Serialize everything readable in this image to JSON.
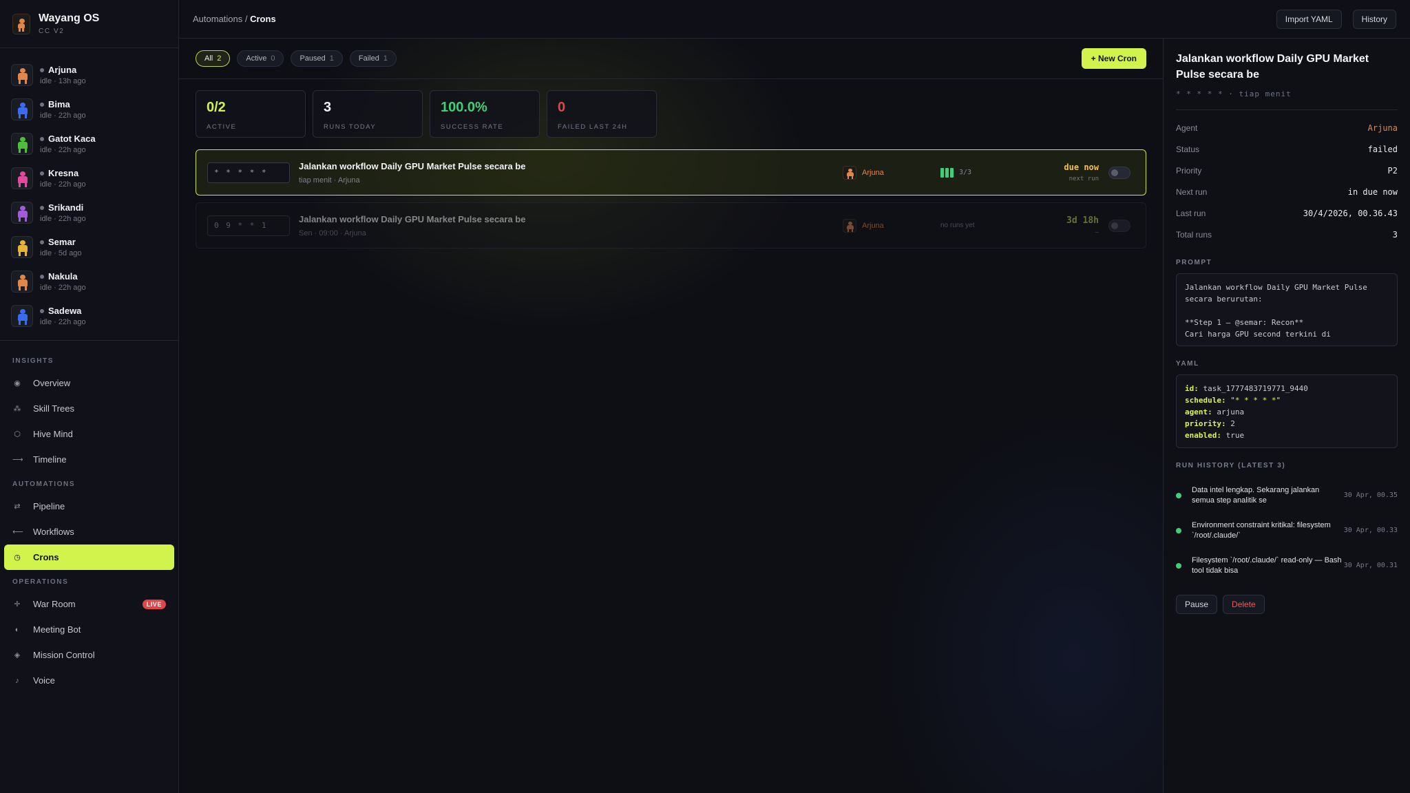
{
  "app": {
    "title": "Wayang OS",
    "subtitle": "CC V2"
  },
  "agents": [
    {
      "name": "Arjuna",
      "status": "idle · 13h ago",
      "color": "#e0874a"
    },
    {
      "name": "Bima",
      "status": "idle · 22h ago",
      "color": "#3b6cf0"
    },
    {
      "name": "Gatot Kaca",
      "status": "idle · 22h ago",
      "color": "#4fbf3a"
    },
    {
      "name": "Kresna",
      "status": "idle · 22h ago",
      "color": "#e04a9a"
    },
    {
      "name": "Srikandi",
      "status": "idle · 22h ago",
      "color": "#a25bd8"
    },
    {
      "name": "Semar",
      "status": "idle · 5d ago",
      "color": "#e6b43a"
    },
    {
      "name": "Nakula",
      "status": "idle · 22h ago",
      "color": "#e0874a"
    },
    {
      "name": "Sadewa",
      "status": "idle · 22h ago",
      "color": "#3b6cf0"
    }
  ],
  "nav": {
    "insights_label": "INSIGHTS",
    "overview": "Overview",
    "skill_trees": "Skill Trees",
    "hive_mind": "Hive Mind",
    "timeline": "Timeline",
    "automations_label": "AUTOMATIONS",
    "pipeline": "Pipeline",
    "workflows": "Workflows",
    "crons": "Crons",
    "operations_label": "OPERATIONS",
    "war_room": "War Room",
    "live_badge": "LIVE",
    "meeting_bot": "Meeting Bot",
    "mission_control": "Mission Control",
    "voice": "Voice"
  },
  "topbar": {
    "crumb_parent": "Automations",
    "crumb_sep": " / ",
    "crumb_current": "Crons",
    "import_label": "Import YAML",
    "history_label": "History"
  },
  "filters": {
    "all": {
      "label": "All",
      "count": "2"
    },
    "active": {
      "label": "Active",
      "count": "0"
    },
    "paused": {
      "label": "Paused",
      "count": "1"
    },
    "failed": {
      "label": "Failed",
      "count": "1"
    },
    "new_cron_label": "+ New Cron"
  },
  "stats": [
    {
      "value": "0/2",
      "label": "ACTIVE",
      "color": "#d2f34c"
    },
    {
      "value": "3",
      "label": "RUNS TODAY",
      "color": "#f1f2f5"
    },
    {
      "value": "100.0%",
      "label": "SUCCESS RATE",
      "color": "#3fcf7a"
    },
    {
      "value": "0",
      "label": "FAILED LAST 24H",
      "color": "#e04747"
    }
  ],
  "crons": [
    {
      "schedule": "* * * * *",
      "title": "Jalankan workflow Daily GPU Market Pulse secara be",
      "sub": "tiap menit · Arjuna",
      "agent": "Arjuna",
      "runs": "3/3",
      "next": "due now",
      "next_sub": "next run"
    },
    {
      "schedule": "0 9 * * 1",
      "title": "Jalankan workflow Daily GPU Market Pulse secara be",
      "sub": "Sen · 09:00 · Arjuna",
      "agent": "Arjuna",
      "runs": "no runs yet",
      "next": "3d 18h",
      "next_sub": "—"
    }
  ],
  "detail": {
    "title": "Jalankan workflow Daily GPU Market Pulse secara be",
    "schedule": "* * * * * · tiap menit",
    "agent_k": "Agent",
    "agent_v": "Arjuna",
    "status_k": "Status",
    "status_v": "failed",
    "priority_k": "Priority",
    "priority_v": "P2",
    "next_k": "Next run",
    "next_v": "in due now",
    "last_k": "Last run",
    "last_v": "30/4/2026, 00.36.43",
    "total_k": "Total runs",
    "total_v": "3",
    "prompt_label": "PROMPT",
    "prompt_text": "Jalankan workflow Daily GPU Market Pulse\nsecara berurutan:\n\n**Step 1 — @semar: Recon**\nCari harga GPU second terkini di",
    "yaml_label": "YAML",
    "yaml": {
      "id_k": "id:",
      "id_v": "task_1777483719771_9440",
      "schedule_k": "schedule:",
      "schedule_v": "\"* * * * *\"",
      "agent_k": "agent:",
      "agent_v": "arjuna",
      "priority_k": "priority:",
      "priority_v": "2",
      "enabled_k": "enabled:",
      "enabled_v": "true"
    },
    "history_label": "RUN HISTORY (LATEST 3)",
    "history": [
      {
        "text": "Data intel lengkap. Sekarang jalankan semua step analitik se",
        "time": "30 Apr, 00.35"
      },
      {
        "text": "Environment constraint kritikal: filesystem `/root/.claude/`",
        "time": "30 Apr, 00.33"
      },
      {
        "text": "Filesystem `/root/.claude/` read-only — Bash tool tidak bisa",
        "time": "30 Apr, 00.31"
      }
    ],
    "pause_label": "Pause",
    "delete_label": "Delete"
  }
}
